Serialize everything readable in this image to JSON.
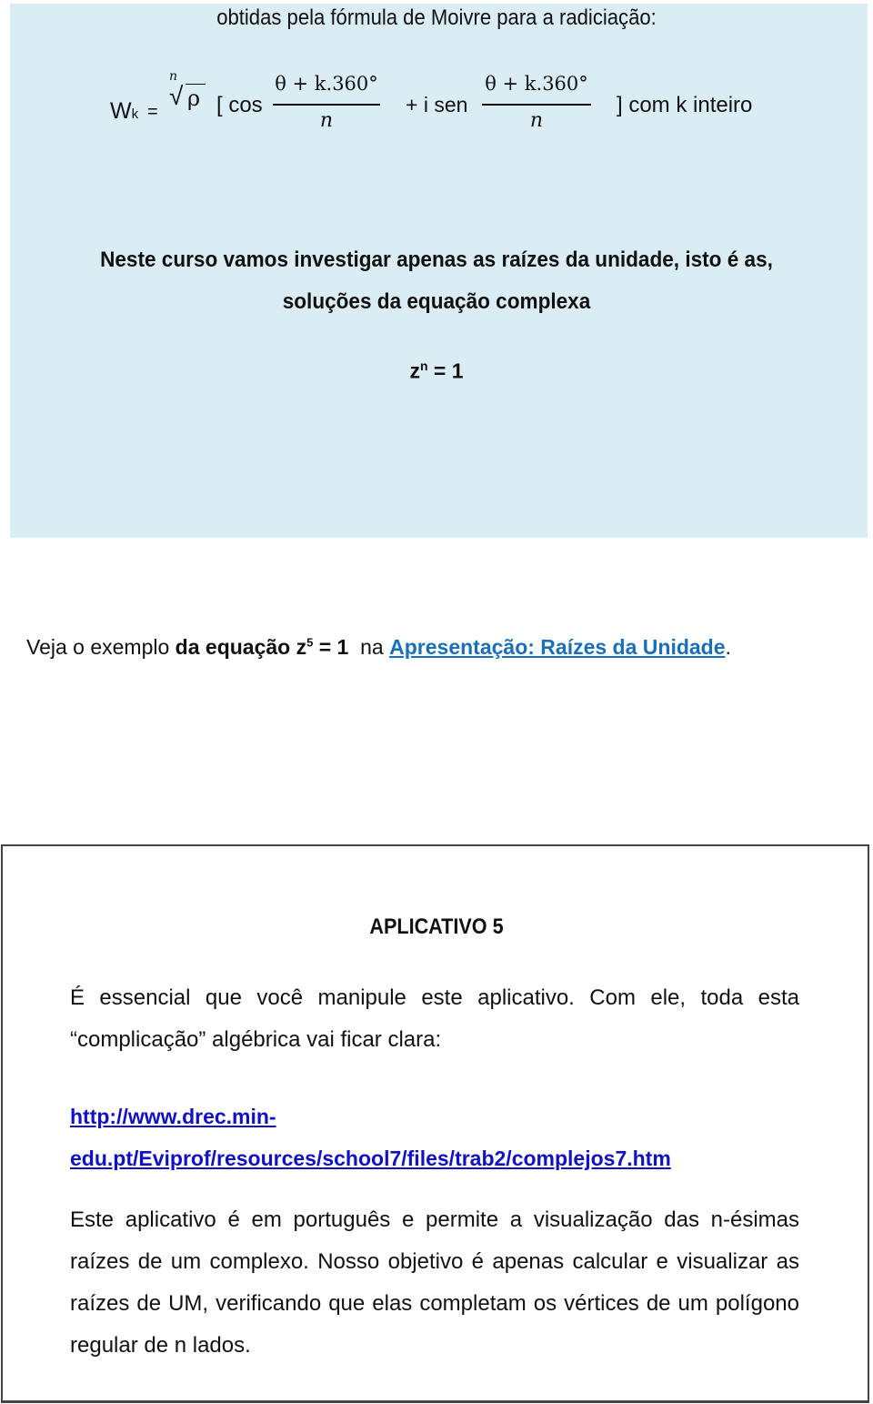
{
  "top_section": {
    "intro": "obtidas pela fórmula de Moivre para a radiciação:",
    "formula": {
      "lhs_W": "W",
      "lhs_sub": "k",
      "equals": "=",
      "root_index": "n",
      "radicand": "ρ",
      "open_bracket": "[ cos",
      "numerator_1": "θ + k.360°",
      "denominator_1": "n",
      "plus_i_sen": "+ i sen",
      "numerator_2": "θ + k.360°",
      "denominator_2": "n",
      "close": "] com k inteiro"
    },
    "paragraph_line1": "Neste curso vamos investigar apenas as raízes da unidade, isto é as,",
    "paragraph_line2": "soluções da equação complexa",
    "equation": {
      "base": "z",
      "exp": "n",
      "rest": " = 1"
    },
    "background_color": "#dbedf4"
  },
  "example": {
    "prefix": "Veja o exemplo ",
    "bold_part": "da  equação  z",
    "exp": "5",
    "bold_rest": " = 1",
    "middle": "  na ",
    "link_text": "Apresentação: Raízes da Unidade",
    "suffix": ".",
    "link_color": "#1a6fba"
  },
  "app_box": {
    "title": "APLICATIVO 5",
    "paragraph1": "É essencial que você manipule este aplicativo. Com ele, toda esta “complicação” algébrica vai ficar clara:",
    "url_line1": "http://www.drec.min-",
    "url_line2": "edu.pt/Eviprof/resources/school7/files/trab2/complejos7.htm",
    "paragraph2": "Este aplicativo é em português e permite a visualização das n-ésimas raízes de um complexo. Nosso objetivo é apenas calcular e visualizar as raízes de UM, verificando que elas completam os vértices de um polígono regular de n lados.",
    "url_color": "#1010c8"
  }
}
